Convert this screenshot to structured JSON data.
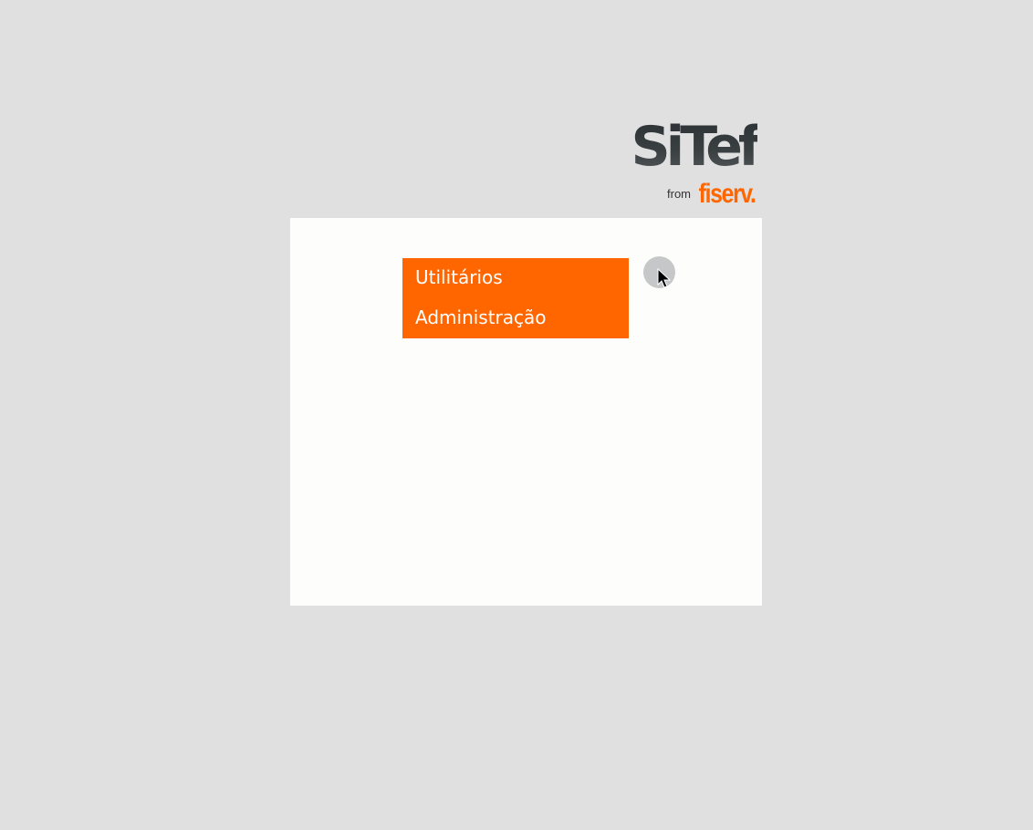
{
  "logo": {
    "main_text": "SiTef",
    "from_text": "from",
    "brand_text": "fiserv."
  },
  "menu": {
    "items": [
      {
        "label": "Utilitários"
      },
      {
        "label": "Administração"
      }
    ]
  },
  "colors": {
    "background": "#e0e0e0",
    "panel": "#fdfdfb",
    "accent": "#ff6600",
    "logo_dark": "#2e3436"
  }
}
